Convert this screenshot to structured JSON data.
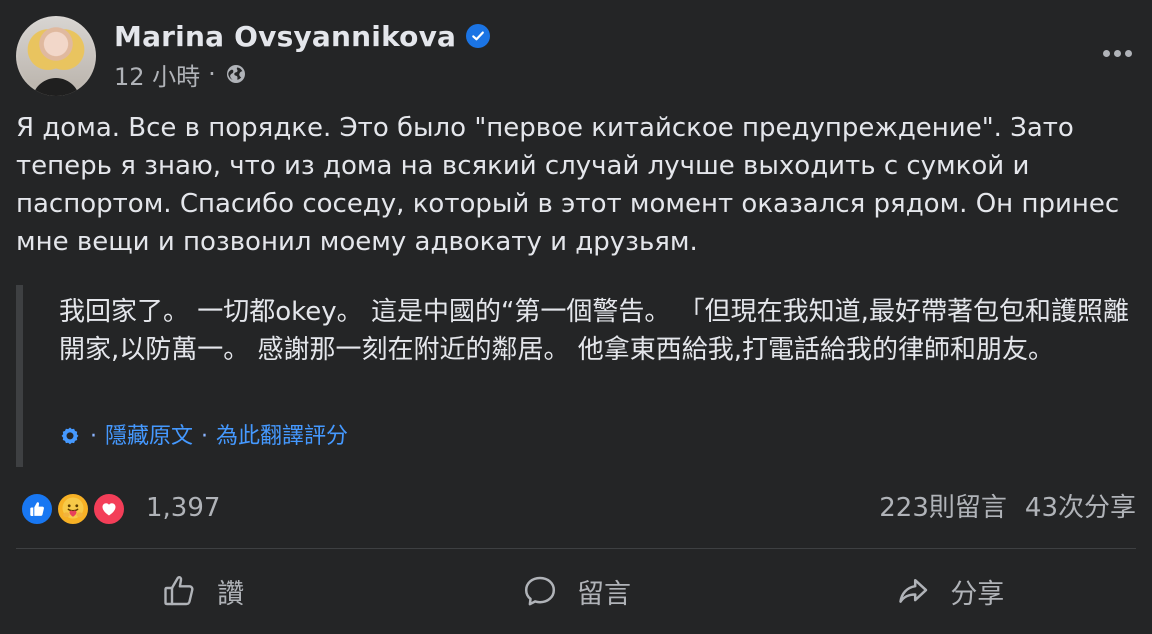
{
  "post": {
    "author_name": "Marina Ovsyannikova",
    "timestamp": "12 小時",
    "meta_separator": "·",
    "icons": {
      "verified": "verified-badge-icon",
      "visibility": "globe-icon",
      "more": "more-options-icon"
    },
    "body": "Я дома. Все в порядке. Это было \"первое китайское предупреждение\".  Зато теперь я знаю, что из дома на всякий случай лучше выходить с сумкой и паспортом. Спасибо соседу, который в этот момент оказался рядом. Он принес мне вещи и позвонил моему адвокату и друзьям.",
    "translation": {
      "text": "我回家了。 一切都okey。 這是中國的“第一個警告。 「但現在我知道,最好帶著包包和護照離開家,以防萬一。 感謝那一刻在附近的鄰居。 他拿東西給我,打電話給我的律師和朋友。",
      "separator_1": "·",
      "hide_original_label": "隱藏原文",
      "separator_2": "·",
      "rate_label": "為此翻譯評分"
    },
    "reactions": {
      "types": [
        "like",
        "care",
        "love"
      ],
      "count": "1,397"
    },
    "comments_count": "223則留言",
    "shares_count": "43次分享",
    "actions": {
      "like_label": "讚",
      "comment_label": "留言",
      "share_label": "分享"
    },
    "colors": {
      "background": "#242526",
      "primary_text": "#e4e6eb",
      "secondary_text": "#b0b3b8",
      "link": "#4599ff",
      "verified": "#1b74e4",
      "like": "#1877f2",
      "care": "#f7b125",
      "love": "#f33e58"
    }
  }
}
